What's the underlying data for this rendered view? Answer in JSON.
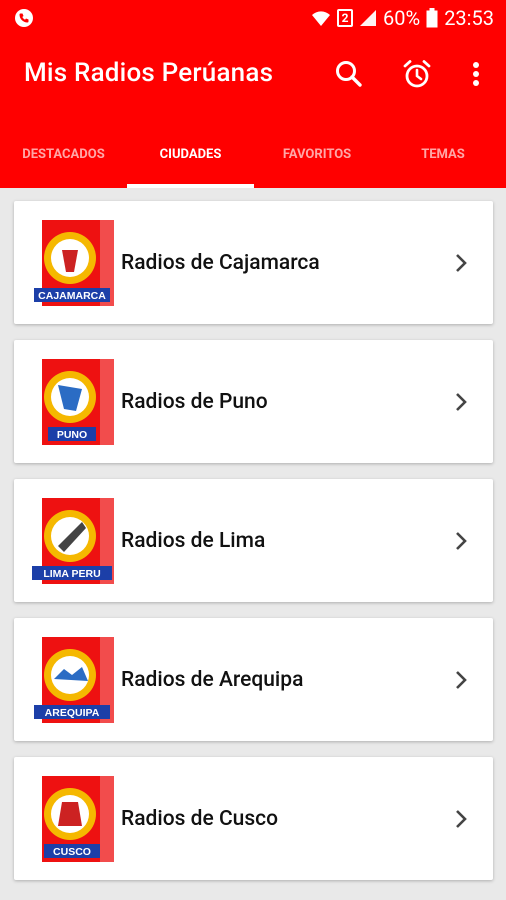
{
  "status": {
    "battery": "60%",
    "time": "23:53",
    "sim": "2"
  },
  "appbar": {
    "title": "Mis Radios Perúanas",
    "icons": [
      "search-icon",
      "alarm-icon",
      "more-vert-icon"
    ]
  },
  "tabs": [
    {
      "label": "DESTACADOS",
      "active": false
    },
    {
      "label": "CIUDADES",
      "active": true
    },
    {
      "label": "FAVORITOS",
      "active": false
    },
    {
      "label": "TEMAS",
      "active": false
    }
  ],
  "cities": [
    {
      "label": "Radios de Cajamarca",
      "logo_text": "CAJAMARCA"
    },
    {
      "label": "Radios de Puno",
      "logo_text": "PUNO"
    },
    {
      "label": "Radios de Lima",
      "logo_text": "LIMA PERU"
    },
    {
      "label": "Radios de Arequipa",
      "logo_text": "AREQUIPA"
    },
    {
      "label": "Radios de Cusco",
      "logo_text": "CUSCO"
    }
  ],
  "colors": {
    "primary": "#ff0000",
    "background": "#e9e9e9",
    "card": "#ffffff"
  }
}
